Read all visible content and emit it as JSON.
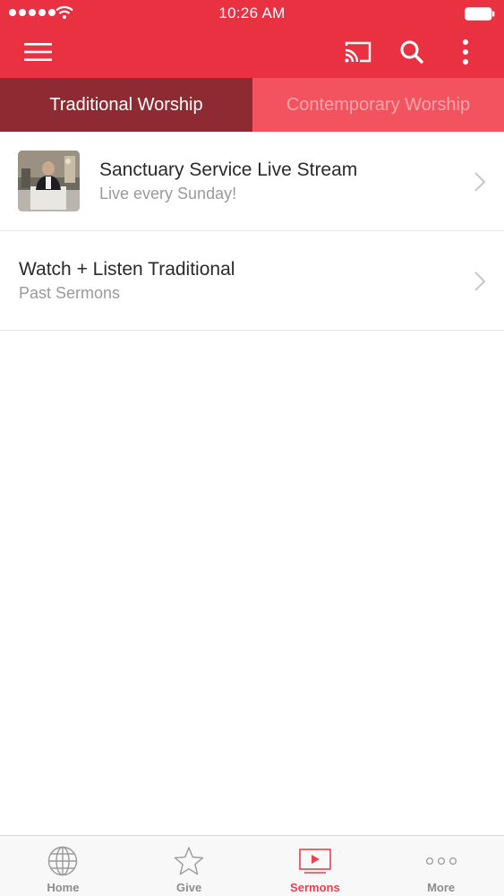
{
  "status_bar": {
    "time": "10:26 AM"
  },
  "toolbar": {
    "icons": [
      "menu-icon",
      "cast-icon",
      "search-icon",
      "more-vertical-icon"
    ]
  },
  "tabs": [
    {
      "label": "Traditional Worship",
      "active": true
    },
    {
      "label": "Contemporary Worship",
      "active": false
    }
  ],
  "list": [
    {
      "title": "Sanctuary Service Live Stream",
      "subtitle": "Live every Sunday!",
      "has_thumbnail": true
    },
    {
      "title": "Watch + Listen Traditional",
      "subtitle": "Past Sermons",
      "has_thumbnail": false
    }
  ],
  "tabbar": [
    {
      "label": "Home",
      "icon": "globe-icon",
      "active": false
    },
    {
      "label": "Give",
      "icon": "star-icon",
      "active": false
    },
    {
      "label": "Sermons",
      "icon": "video-play-icon",
      "active": true
    },
    {
      "label": "More",
      "icon": "more-horizontal-icon",
      "active": false
    }
  ],
  "colors": {
    "brand_red": "#ea3142",
    "tab_active_bg": "#8e2a32",
    "tab_inactive_bg": "#f3525f",
    "tabbar_active": "#e8414f"
  }
}
